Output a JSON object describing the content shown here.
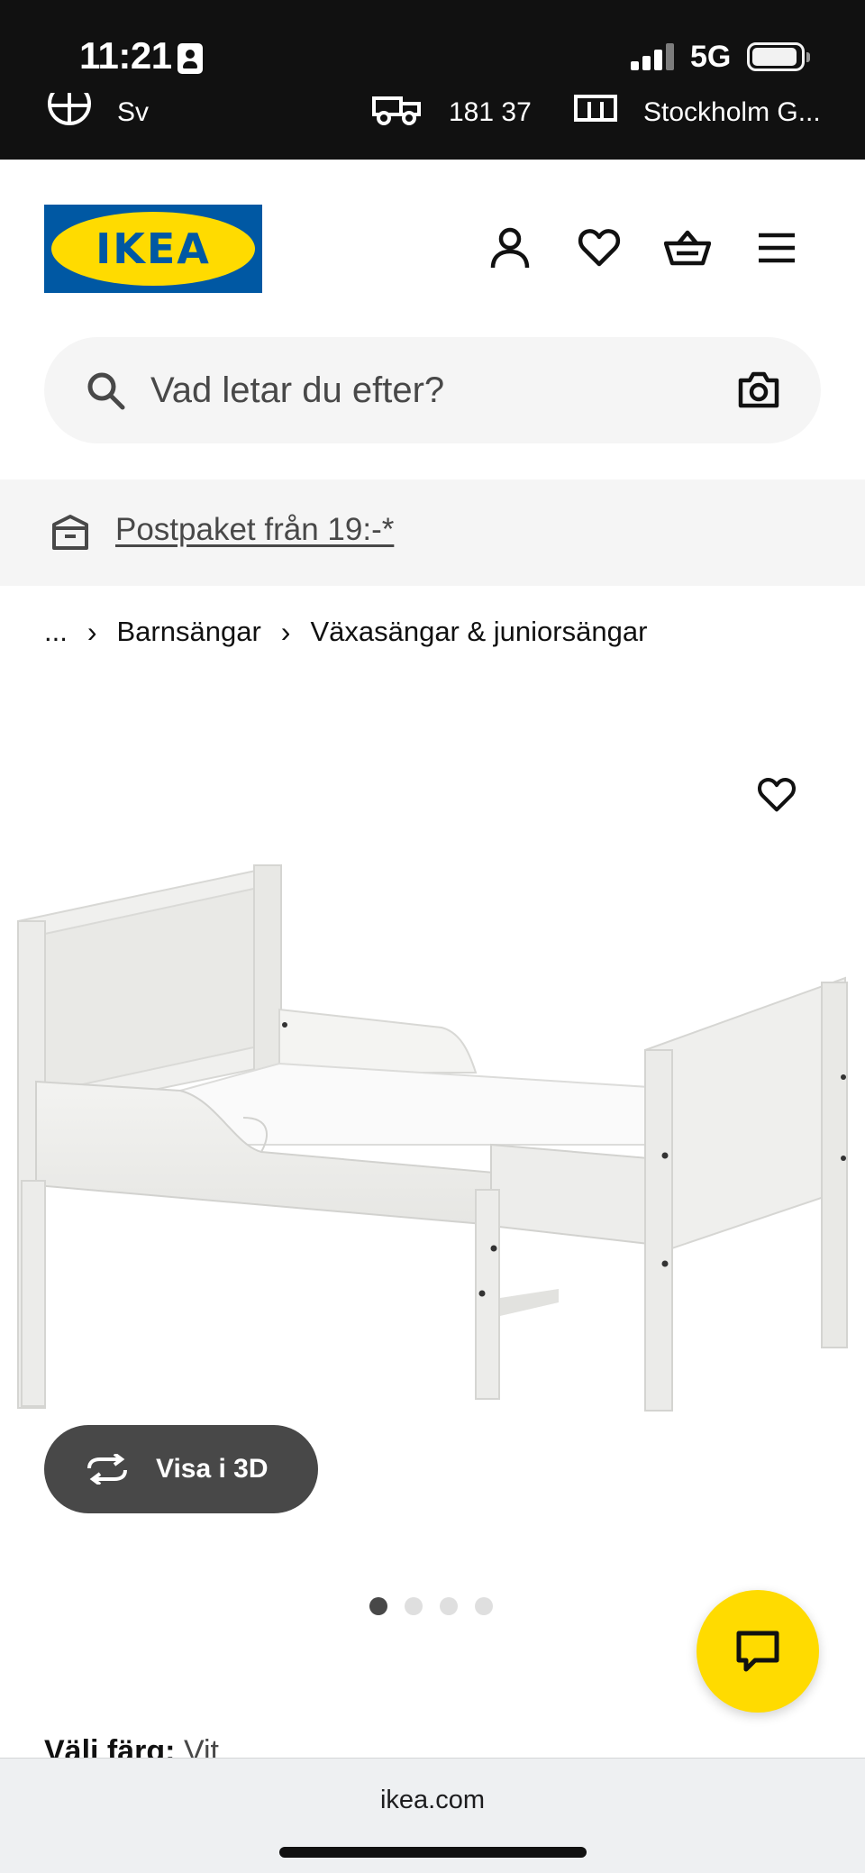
{
  "status_bar": {
    "time": "11:21",
    "network": "5G",
    "battery_level": 0.9,
    "signal_bars": 4,
    "utility": {
      "language": "Sv",
      "postcode": "181 37",
      "store": "Stockholm G..."
    }
  },
  "header": {
    "logo_text": "IKEA",
    "icons": [
      "profile-icon",
      "heart-icon",
      "basket-icon",
      "menu-icon"
    ]
  },
  "search": {
    "placeholder": "Vad letar du efter?"
  },
  "promo": {
    "text": "Postpaket från 19:-*"
  },
  "breadcrumb": {
    "ellipsis": "...",
    "items": [
      "Barnsängar",
      "Växasängar & juniorsängar"
    ]
  },
  "product": {
    "view_3d_label": "Visa i 3D",
    "carousel_count": 4,
    "carousel_active": 1,
    "color_label": "Välj färg:",
    "color_value": "Vit"
  },
  "browser": {
    "url": "ikea.com"
  },
  "colors": {
    "brand_blue": "#0058a3",
    "brand_yellow": "#ffdb00",
    "dark_gray": "#484848"
  }
}
